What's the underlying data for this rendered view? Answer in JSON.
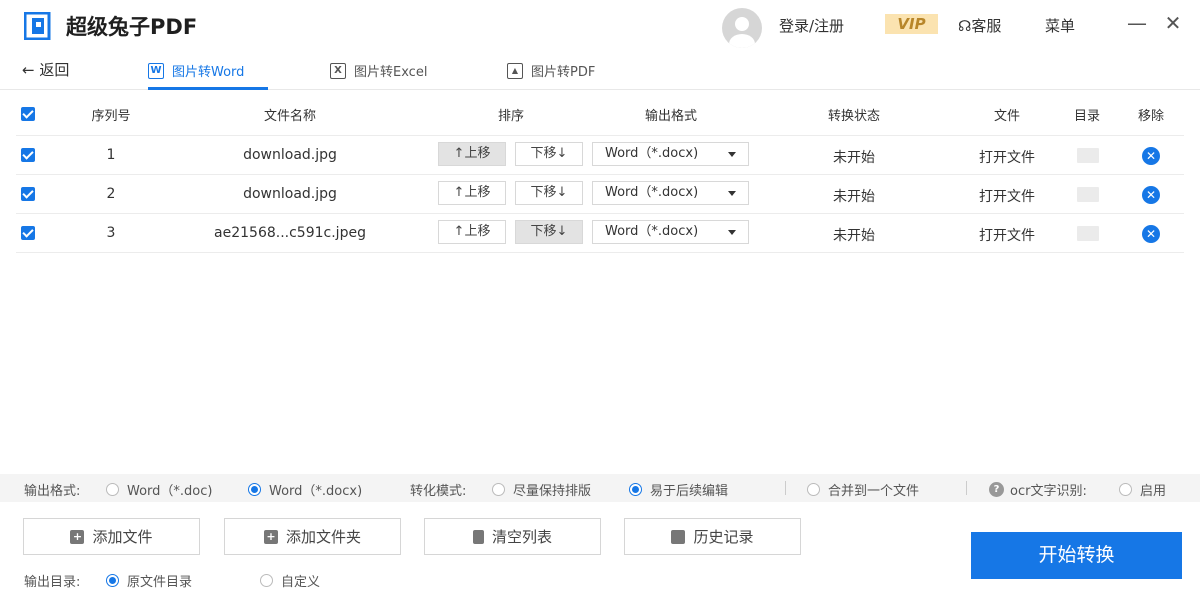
{
  "app": {
    "title": "超级兔子PDF",
    "login": "登录/注册",
    "vip": "VIP",
    "service": "客服",
    "menu": "菜单",
    "minimize": "—",
    "close": "✕"
  },
  "nav": {
    "back": "返回",
    "tabs": [
      {
        "label": "图片转Word",
        "icon": "W",
        "active": true
      },
      {
        "label": "图片转Excel",
        "icon": "X",
        "active": false
      },
      {
        "label": "图片转PDF",
        "icon": "▲",
        "active": false
      }
    ]
  },
  "table": {
    "headers": {
      "index": "序列号",
      "name": "文件名称",
      "order": "排序",
      "format": "输出格式",
      "status": "转换状态",
      "file": "文件",
      "dir": "目录",
      "remove": "移除"
    },
    "rows": [
      {
        "index": "1",
        "name": "download.jpg",
        "up": "↑上移",
        "down": "下移↓",
        "format": "Word（*.docx)",
        "status": "未开始",
        "open": "打开文件"
      },
      {
        "index": "2",
        "name": "download.jpg",
        "up": "↑上移",
        "down": "下移↓",
        "format": "Word（*.docx)",
        "status": "未开始",
        "open": "打开文件"
      },
      {
        "index": "3",
        "name": "ae21568...c591c.jpeg",
        "up": "↑上移",
        "down": "下移↓",
        "format": "Word（*.docx)",
        "status": "未开始",
        "open": "打开文件"
      }
    ]
  },
  "options": {
    "format_label": "输出格式:",
    "format_doc": "Word（*.doc)",
    "format_docx": "Word（*.docx)",
    "mode_label": "转化模式:",
    "mode_layout": "尽量保持排版",
    "mode_edit": "易于后续编辑",
    "merge": "合并到一个文件",
    "ocr_label": "ocr文字识别:",
    "ocr_enable": "启用"
  },
  "buttons": {
    "add_file": "添加文件",
    "add_folder": "添加文件夹",
    "clear": "清空列表",
    "history": "历史记录",
    "start": "开始转换"
  },
  "output": {
    "label": "输出目录:",
    "original": "原文件目录",
    "custom": "自定义"
  },
  "colors": {
    "accent": "#1677e6",
    "vip_bg": "#fbe3b0"
  }
}
